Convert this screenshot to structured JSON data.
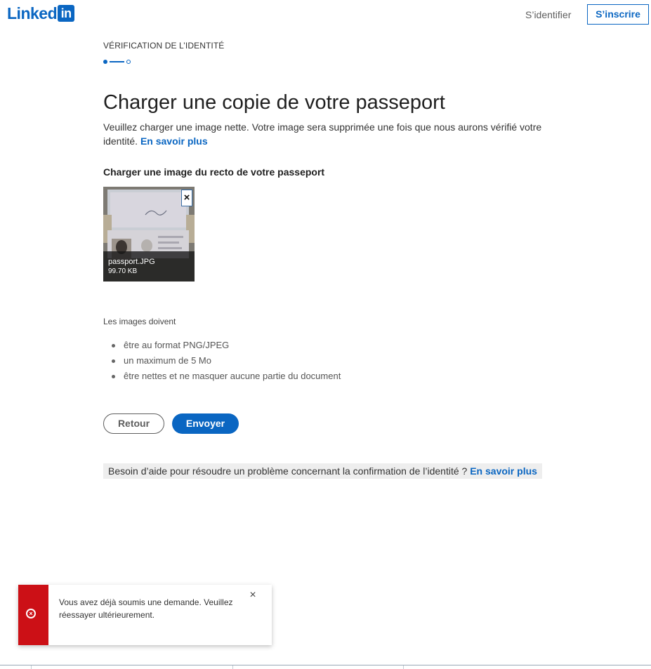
{
  "header": {
    "logo_word": "Linked",
    "logo_box": "in",
    "signin_label": "S’identifier",
    "join_label": "S’inscrire"
  },
  "stepper": {
    "label": "VÉRIFICATION DE L’IDENTITÉ",
    "current_step": 1,
    "total_steps": 2
  },
  "page": {
    "title": "Charger une copie de votre passeport",
    "description": "Veuillez charger une image nette. Votre image sera supprimée une fois que nous aurons vérifié votre identité.",
    "learn_more": "En savoir plus",
    "upload_title": "Charger une image du recto de votre passeport"
  },
  "upload": {
    "file_name": "passport.JPG",
    "file_size": "99.70 KB",
    "remove_icon": "close-icon"
  },
  "requirements": {
    "title": "Les images doivent",
    "items": [
      "être au format PNG/JPEG",
      "un maximum de 5 Mo",
      "être nettes et ne masquer aucune partie du document"
    ]
  },
  "actions": {
    "back_label": "Retour",
    "send_label": "Envoyer"
  },
  "help": {
    "text": "Besoin d’aide pour résoudre un problème concernant la confirmation de l’identité ?",
    "link": "En savoir plus"
  },
  "toast": {
    "message": "Vous avez déjà soumis une demande. Veuillez réessayer ultérieurement.",
    "icon": "error-icon",
    "close_icon": "close-icon"
  },
  "colors": {
    "brand": "#0a66c2",
    "error": "#cc1016",
    "help_bg": "#eeeeee"
  }
}
